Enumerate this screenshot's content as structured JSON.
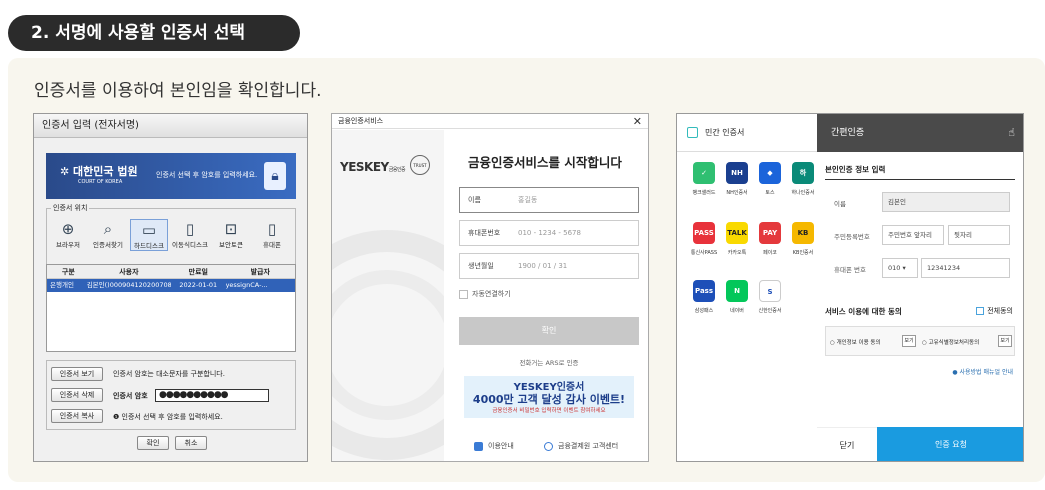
{
  "section_title": "2. 서명에 사용할 인증서 선택",
  "intro": "인증서를 이용하여 본인임을 확인합니다.",
  "p1": {
    "title": "인증서 입력 (전자서명)",
    "court": "대한민국 법원",
    "court_en": "COURT OF KOREA",
    "banner_msg": "인증서 선택 후 암호를 입력하세요.",
    "location_legend": "인증서 위치",
    "locations": [
      "브라우저",
      "인증서찾기",
      "하드디스크",
      "이동식디스크",
      "보안토큰",
      "휴대폰"
    ],
    "headers": [
      "구분",
      "사용자",
      "만료일",
      "발급자"
    ],
    "row": [
      "은행개인",
      "김본인()0009041202007080...",
      "2022-01-01",
      "yessignCA-..."
    ],
    "btn_view": "인증서 보기",
    "btn_delete": "인증서 삭제",
    "btn_copy": "인증서 복사",
    "case_note": "인증서 암호는 대소문자를 구분합니다.",
    "pw_label": "인증서 암호",
    "pw_value": "●●●●●●●●●●",
    "pw_hint": "인증서 선택 후 암호를 입력하세요.",
    "ok": "확인",
    "cancel": "취소"
  },
  "p2": {
    "window_title": "금융인증서비스",
    "logo": "YESKEY",
    "logo_sub": "금융인증",
    "emblem": "TRUST",
    "title": "금융인증서비스를 시작합니다",
    "name_label": "이름",
    "name_ph": "홍길동",
    "phone_label": "휴대폰번호",
    "phone_ph": "010 - 1234 - 5678",
    "birth_label": "생년월일",
    "birth_ph": "1900 / 01 / 31",
    "auto": "자동연결하기",
    "confirm": "확인",
    "ars": "전화거는 ARS로 인증",
    "event1": "YESKEY인증서",
    "event2": "4000만 고객 달성 감사 이벤트!",
    "event3": "금융인증서 비밀번호 입력하면 이벤트 참여하세요",
    "guide": "이용안내",
    "center": "금융결제원 고객센터"
  },
  "p3": {
    "left_title": "민간 인증서",
    "providers": [
      {
        "name": "뱅크샐러드",
        "color": "#2fbf71",
        "mark": "✓"
      },
      {
        "name": "NH인증서",
        "color": "#1a3f8f",
        "mark": "NH"
      },
      {
        "name": "토스",
        "color": "#1b64da",
        "mark": "◆"
      },
      {
        "name": "하나인증서",
        "color": "#0a8a78",
        "mark": "하"
      },
      {
        "name": "통신사PASS",
        "color": "#e8323b",
        "mark": "PASS"
      },
      {
        "name": "카카오톡",
        "color": "#f9d900",
        "mark": "TALK"
      },
      {
        "name": "페이코",
        "color": "#e4393c",
        "mark": "PAY"
      },
      {
        "name": "KB인증서",
        "color": "#f5b800",
        "mark": "KB"
      },
      {
        "name": "삼성패스",
        "color": "#1d4fb8",
        "mark": "Pass"
      },
      {
        "name": "네이버",
        "color": "#03c75a",
        "mark": "N"
      },
      {
        "name": "신한인증서",
        "color": "#ffffff",
        "mark": "S"
      }
    ],
    "right_title": "간편인증",
    "info_title": "본인인증 정보 입력",
    "name_label": "이름",
    "name_value": "김본인",
    "rrn_label": "주민등록번호",
    "rrn_front": "주민번호 앞자리",
    "rrn_back": "뒷자리",
    "phone_label": "휴대폰 번호",
    "phone_prefix": "010",
    "phone_value": "12341234",
    "agree_title": "서비스 이용에 대한 동의",
    "agree_all": "전체동의",
    "term1": "개인정보 이용 동의",
    "term2": "고유식별정보처리동의",
    "view": "보기",
    "guide": "사용방법 매뉴얼 안내",
    "close": "닫기",
    "request": "인증 요청"
  }
}
